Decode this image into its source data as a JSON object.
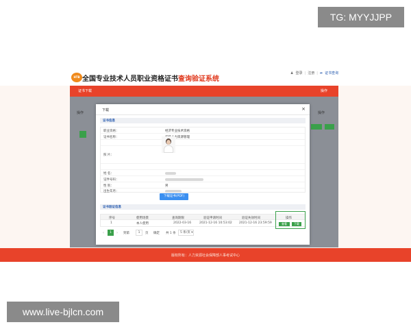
{
  "watermarks": {
    "tg": "TG: MYYJJPP",
    "url": "www.live-bjlcn.com"
  },
  "header": {
    "logo_text": "HTB",
    "title_main": "全国专业技术人员职业资格证书",
    "title_accent": "查询验证系统",
    "links": [
      "登录",
      "|",
      "注册",
      "|",
      "证书查询"
    ]
  },
  "nav": {
    "left": "证书下载",
    "right": "操作"
  },
  "background": {
    "op_left": "操作",
    "op_right": "操作"
  },
  "modal": {
    "title": "下载",
    "close": "×",
    "section1": "证书信息",
    "fields": [
      {
        "label": "职业资格：",
        "value": "经济专业技术资格"
      },
      {
        "label": "证书名称：",
        "value": "初级人力资源管理"
      },
      {
        "label": "",
        "value": ""
      },
      {
        "label": "照 片：",
        "value": ""
      },
      {
        "label": "",
        "value": ""
      },
      {
        "label": "姓 名：",
        "value": ""
      },
      {
        "label": "证件号码：",
        "value": ""
      },
      {
        "label": "性 别：",
        "value": "男"
      },
      {
        "label": "出生年月：",
        "value": ""
      },
      {
        "label": "批准日期：",
        "value": ""
      }
    ],
    "download_btn": "下载证书(PDF)",
    "section2": "证书验证信息",
    "table": {
      "headers": [
        "序号",
        "使用场景",
        "查询期限",
        "验证申请时间",
        "验证失效时间",
        "操作"
      ],
      "rows": [
        [
          "1",
          "本人使用",
          "2022-03-16",
          "2021-12-16 10:53:02",
          "2021-12-16 23:59:59"
        ]
      ],
      "ops": [
        "查看",
        "下载"
      ]
    },
    "pager": {
      "prev": "‹",
      "page": "1",
      "next": "›",
      "goto": "到第",
      "input": "1",
      "page_unit": "页",
      "confirm": "确定",
      "total": "共 1 条",
      "per_page": "5 条/页"
    }
  },
  "footer": "版权所有：人力资源社会保障部人事考试中心"
}
